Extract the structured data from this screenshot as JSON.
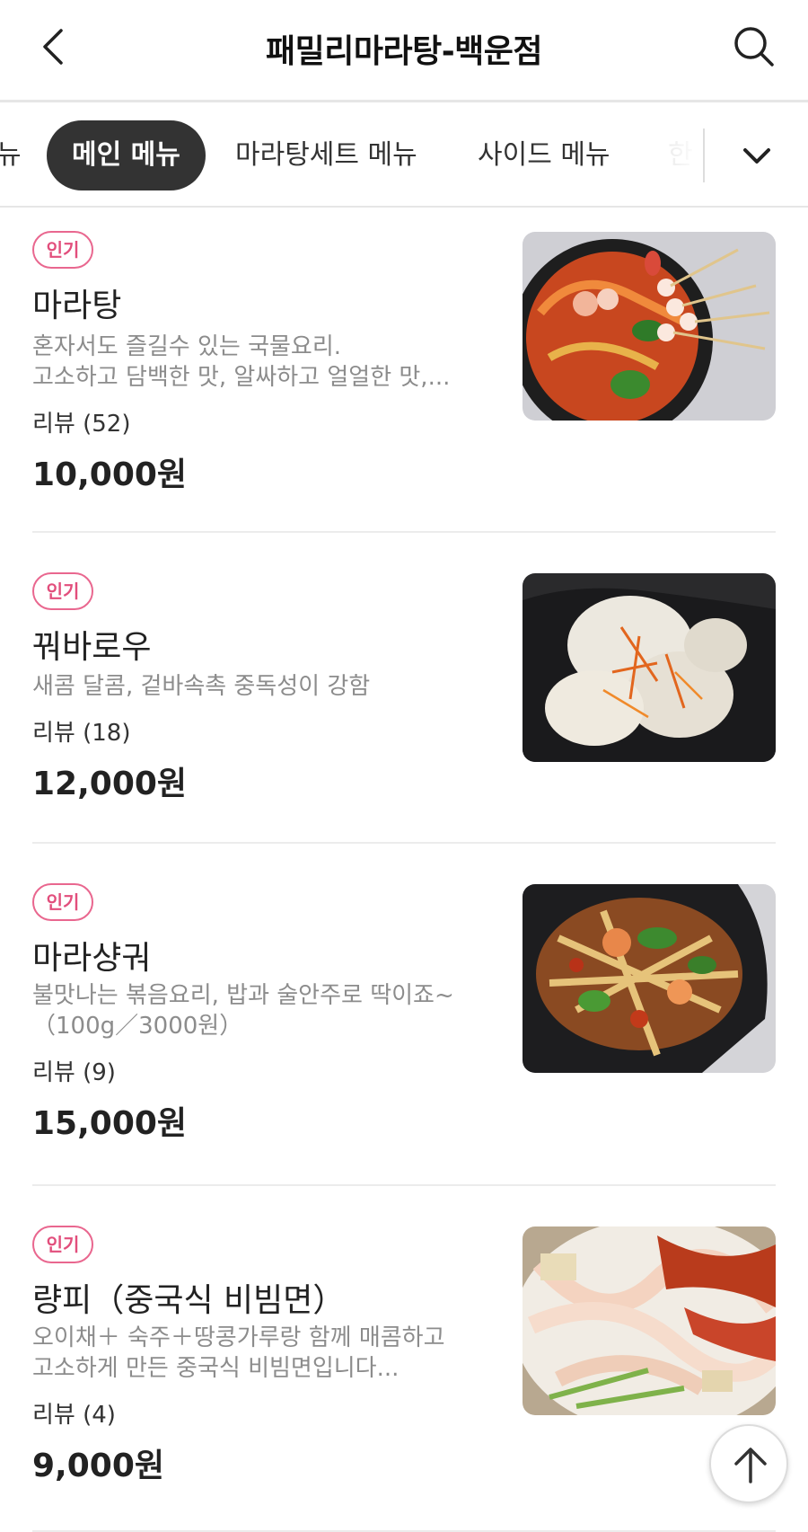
{
  "header": {
    "title": "패밀리마라탕-백운점",
    "back_icon": "chevron-left-icon",
    "search_icon": "search-icon"
  },
  "tabs": [
    {
      "label": "뉴",
      "state": "partial"
    },
    {
      "label": "메인 메뉴",
      "state": "active"
    },
    {
      "label": "마라탕세트 메뉴",
      "state": "normal"
    },
    {
      "label": "사이드 메뉴",
      "state": "normal"
    },
    {
      "label": "한",
      "state": "faded"
    }
  ],
  "expand_icon": "chevron-down-icon",
  "menu_items": [
    {
      "badge": "인기",
      "name": "마라탕",
      "desc_lines": [
        "혼자서도 즐길수 있는 국물요리.",
        "고소하고 담백한 맛, 알싸하고 얼얼한 맛,..."
      ],
      "review": "리뷰 (52)",
      "price": "10,000원"
    },
    {
      "badge": "인기",
      "name": "꿔바로우",
      "desc_lines": [
        "새콤 달콤, 겉바속촉 중독성이 강함"
      ],
      "review": "리뷰 (18)",
      "price": "12,000원"
    },
    {
      "badge": "인기",
      "name": "마라샹궈",
      "desc_lines": [
        "불맛나는 볶음요리, 밥과 술안주로 딱이죠~",
        "（100g／3000원）"
      ],
      "review": "리뷰 (9)",
      "price": "15,000원"
    },
    {
      "badge": "인기",
      "name": "량피（중국식 비빔면）",
      "desc_lines": [
        "오이채＋ 숙주＋땅콩가루랑 함께 매콤하고",
        "고소하게 만든 중국식 비빔면입니다..."
      ],
      "review": "리뷰 (4)",
      "price": "9,000원"
    }
  ],
  "scroll_top_icon": "arrow-up-icon",
  "colors": {
    "badge_accent": "#e24e7c",
    "active_tab_bg": "#333333",
    "divider": "#ececec"
  }
}
